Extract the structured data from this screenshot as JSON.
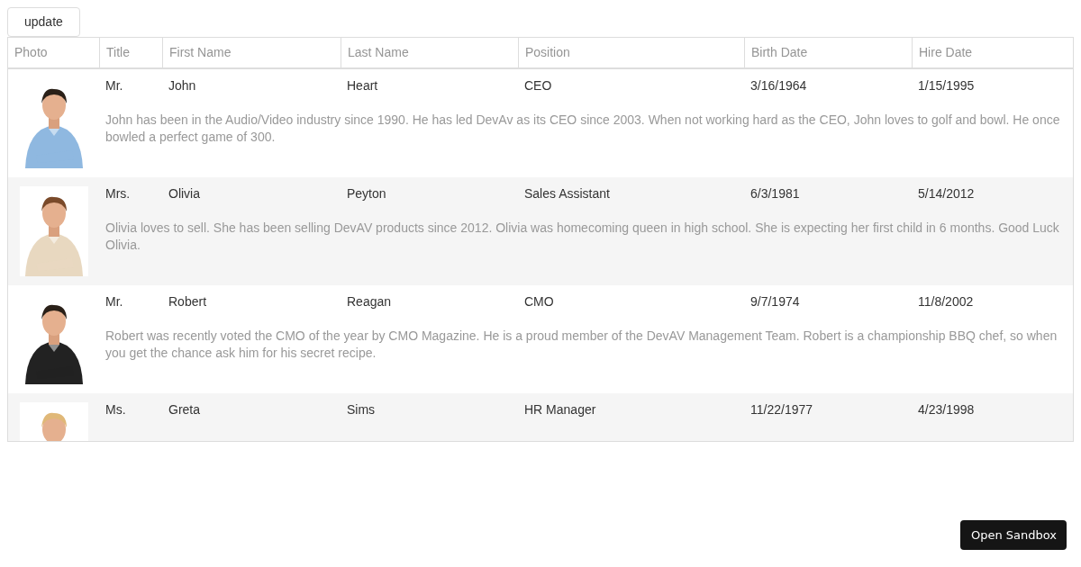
{
  "toolbar": {
    "update_button": "update"
  },
  "table": {
    "columns": [
      "Photo",
      "Title",
      "First Name",
      "Last Name",
      "Position",
      "Birth Date",
      "Hire Date"
    ],
    "rows": [
      {
        "title": "Mr.",
        "first_name": "John",
        "last_name": "Heart",
        "position": "CEO",
        "birth_date": "3/16/1964",
        "hire_date": "1/15/1995",
        "notes": "John has been in the Audio/Video industry since 1990. He has led DevAv as its CEO since 2003. When not working hard as the CEO, John loves to golf and bowl. He once bowled a perfect game of 300."
      },
      {
        "title": "Mrs.",
        "first_name": "Olivia",
        "last_name": "Peyton",
        "position": "Sales Assistant",
        "birth_date": "6/3/1981",
        "hire_date": "5/14/2012",
        "notes": "Olivia loves to sell. She has been selling DevAV products since 2012. Olivia was homecoming queen in high school. She is expecting her first child in 6 months. Good Luck Olivia."
      },
      {
        "title": "Mr.",
        "first_name": "Robert",
        "last_name": "Reagan",
        "position": "CMO",
        "birth_date": "9/7/1974",
        "hire_date": "11/8/2002",
        "notes": "Robert was recently voted the CMO of the year by CMO Magazine. He is a proud member of the DevAV Management Team. Robert is a championship BBQ chef, so when you get the chance ask him for his secret recipe."
      },
      {
        "title": "Ms.",
        "first_name": "Greta",
        "last_name": "Sims",
        "position": "HR Manager",
        "birth_date": "11/22/1977",
        "hire_date": "4/23/1998"
      }
    ]
  },
  "sandbox_button": "Open Sandbox"
}
